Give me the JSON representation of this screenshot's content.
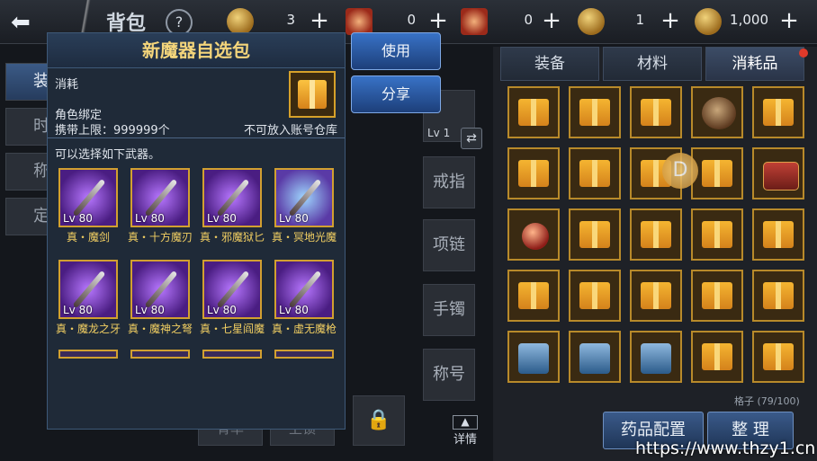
{
  "topbar": {
    "title": "背包",
    "help": "?",
    "resources": [
      {
        "icon": "coin-icon",
        "value": "3"
      },
      {
        "icon": "scroll-icon",
        "value": "0"
      },
      {
        "icon": "ticket-icon",
        "value": "0"
      },
      {
        "icon": "gold-coin-icon",
        "value": "1"
      },
      {
        "icon": "gem-coin-icon",
        "value": "1,000"
      }
    ]
  },
  "popup": {
    "title": "新魔器自选包",
    "item_type": "消耗",
    "bind": "角色绑定",
    "limit": "携带上限：999999个",
    "no_store": "不可放入账号仓库",
    "choose_text": "可以选择如下武器。",
    "weapons": [
      {
        "level": "Lv 80",
        "name": "真・魔剑"
      },
      {
        "level": "Lv 80",
        "name": "真・十方魔刃"
      },
      {
        "level": "Lv 80",
        "name": "真・邪魔狱匕"
      },
      {
        "level": "Lv 80",
        "name": "真・冥地光魔"
      },
      {
        "level": "Lv 80",
        "name": "真・魔龙之牙"
      },
      {
        "level": "Lv 80",
        "name": "真・魔神之弩"
      },
      {
        "level": "Lv 80",
        "name": "真・七星阎魔"
      },
      {
        "level": "Lv 80",
        "name": "真・虚无魔枪"
      }
    ]
  },
  "actions": {
    "use": "使用",
    "share": "分享"
  },
  "equip": {
    "weapon_level": "Lv 1",
    "ring": "戒指",
    "necklace": "项链",
    "bracelet": "手镯",
    "title": "称号",
    "detail": "详情"
  },
  "side_tabs": [
    "装",
    "时",
    "称",
    "定"
  ],
  "bg_buttons": [
    "背率",
    "上锁"
  ],
  "bag": {
    "tabs": [
      "装备",
      "材料",
      "消耗品"
    ],
    "slots_count": "格子 (79/100)",
    "potion_btn": "药品配置",
    "sort_btn": "整 理"
  },
  "watermark": "https://www.thzy1.cn"
}
